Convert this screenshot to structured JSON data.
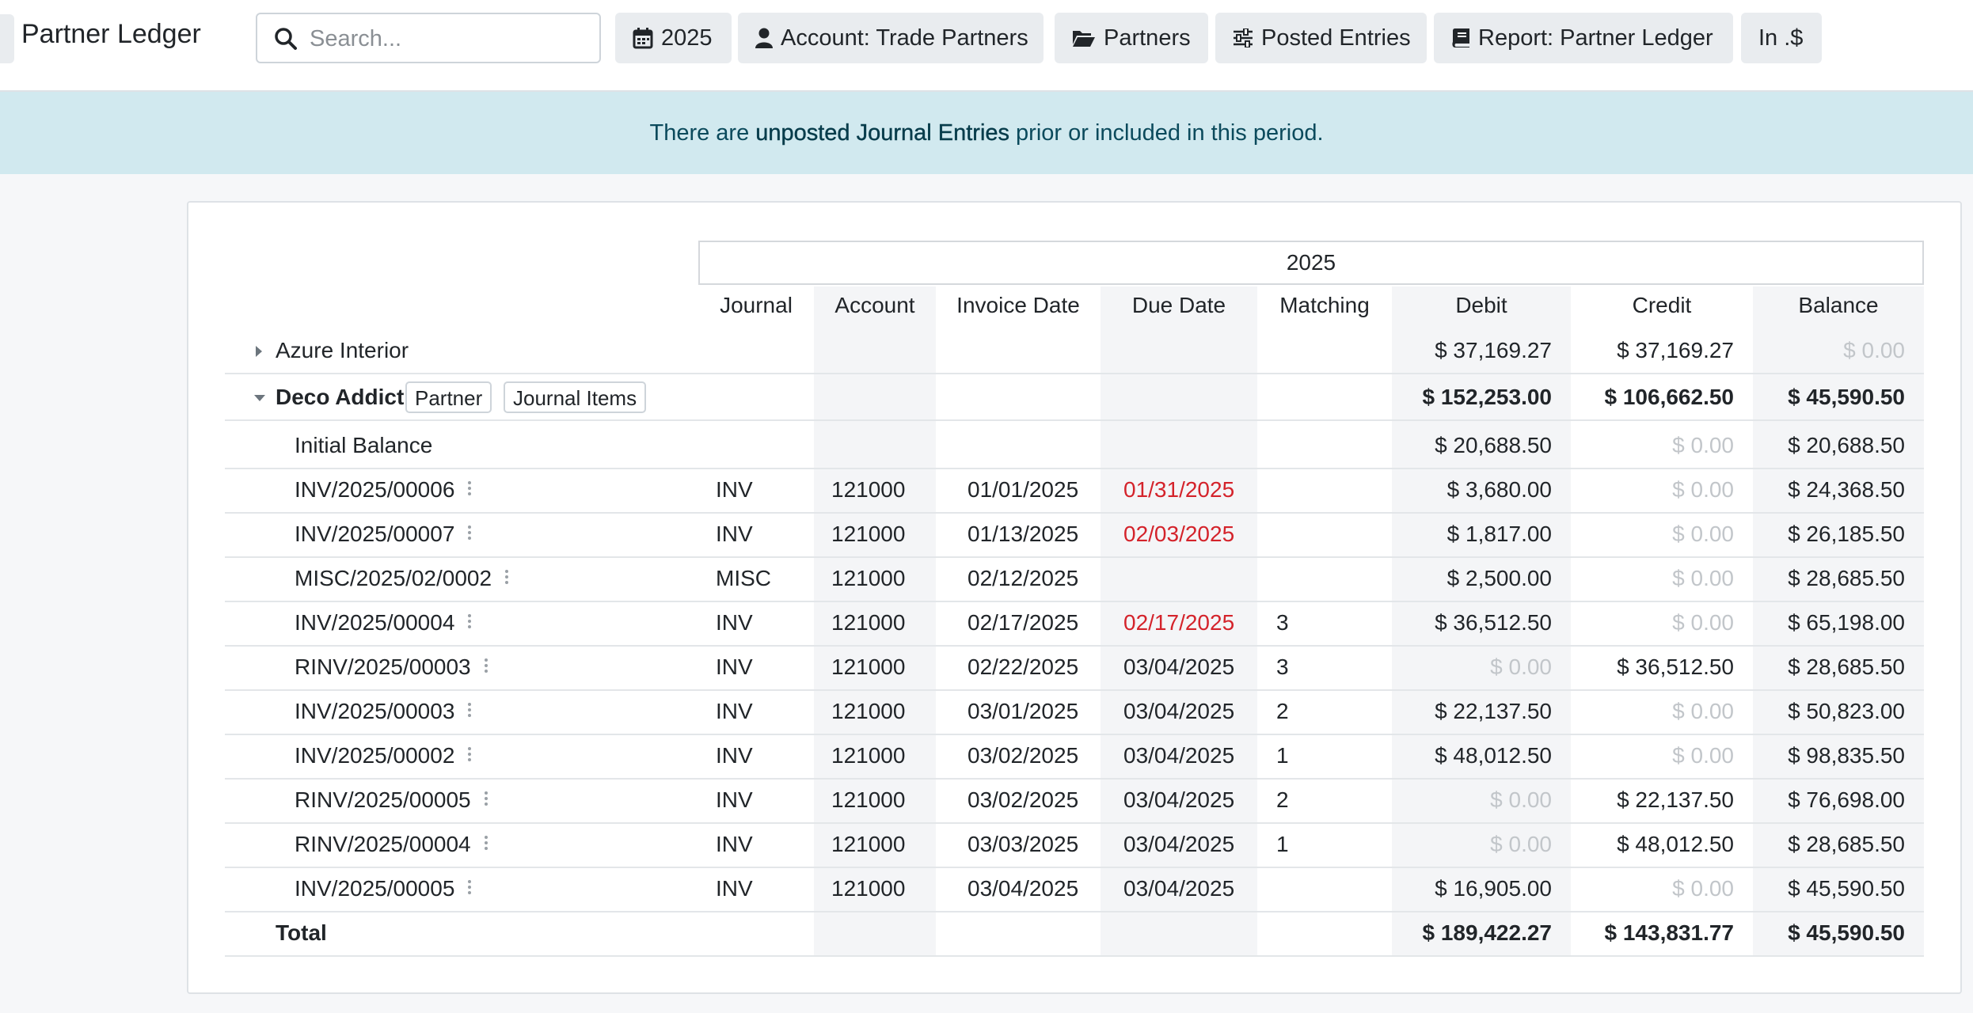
{
  "header": {
    "title": "Partner Ledger",
    "search_placeholder": "Search...",
    "filters": {
      "year": "2025",
      "account": "Account: Trade Partners",
      "partners": "Partners",
      "posted": "Posted Entries",
      "report": "Report: Partner Ledger",
      "currency": "In .$"
    }
  },
  "banner": {
    "prefix": "There are",
    "link": "unposted Journal Entries",
    "suffix": "prior or included in this period."
  },
  "table": {
    "period": "2025",
    "columns": {
      "journal": "Journal",
      "account": "Account",
      "invoice_date": "Invoice Date",
      "due_date": "Due Date",
      "matching": "Matching",
      "debit": "Debit",
      "credit": "Credit",
      "balance": "Balance"
    },
    "partners": [
      {
        "name": "Azure Interior",
        "debit": "$ 37,169.27",
        "credit": "$ 37,169.27",
        "balance": "$ 0.00"
      },
      {
        "name": "Deco Addict",
        "debit": "$ 152,253.00",
        "credit": "$ 106,662.50",
        "balance": "$ 45,590.50",
        "tag_partner": "Partner",
        "tag_items": "Journal Items"
      }
    ],
    "initial_balance": {
      "label": "Initial Balance",
      "debit": "$ 20,688.50",
      "credit": "$ 0.00",
      "balance": "$ 20,688.50"
    },
    "lines": [
      {
        "move": "INV/2025/00006",
        "journal": "INV",
        "account": "121000",
        "invoice_date": "01/01/2025",
        "due_date": "01/31/2025",
        "overdue": true,
        "matching": "",
        "debit": "$ 3,680.00",
        "credit": "$ 0.00",
        "balance": "$ 24,368.50"
      },
      {
        "move": "INV/2025/00007",
        "journal": "INV",
        "account": "121000",
        "invoice_date": "01/13/2025",
        "due_date": "02/03/2025",
        "overdue": true,
        "matching": "",
        "debit": "$ 1,817.00",
        "credit": "$ 0.00",
        "balance": "$ 26,185.50"
      },
      {
        "move": "MISC/2025/02/0002",
        "journal": "MISC",
        "account": "121000",
        "invoice_date": "02/12/2025",
        "due_date": "",
        "overdue": false,
        "matching": "",
        "debit": "$ 2,500.00",
        "credit": "$ 0.00",
        "balance": "$ 28,685.50"
      },
      {
        "move": "INV/2025/00004",
        "journal": "INV",
        "account": "121000",
        "invoice_date": "02/17/2025",
        "due_date": "02/17/2025",
        "overdue": true,
        "matching": "3",
        "debit": "$ 36,512.50",
        "credit": "$ 0.00",
        "balance": "$ 65,198.00"
      },
      {
        "move": "RINV/2025/00003",
        "journal": "INV",
        "account": "121000",
        "invoice_date": "02/22/2025",
        "due_date": "03/04/2025",
        "overdue": false,
        "matching": "3",
        "debit": "$ 0.00",
        "credit": "$ 36,512.50",
        "balance": "$ 28,685.50"
      },
      {
        "move": "INV/2025/00003",
        "journal": "INV",
        "account": "121000",
        "invoice_date": "03/01/2025",
        "due_date": "03/04/2025",
        "overdue": false,
        "matching": "2",
        "debit": "$ 22,137.50",
        "credit": "$ 0.00",
        "balance": "$ 50,823.00"
      },
      {
        "move": "INV/2025/00002",
        "journal": "INV",
        "account": "121000",
        "invoice_date": "03/02/2025",
        "due_date": "03/04/2025",
        "overdue": false,
        "matching": "1",
        "debit": "$ 48,012.50",
        "credit": "$ 0.00",
        "balance": "$ 98,835.50"
      },
      {
        "move": "RINV/2025/00005",
        "journal": "INV",
        "account": "121000",
        "invoice_date": "03/02/2025",
        "due_date": "03/04/2025",
        "overdue": false,
        "matching": "2",
        "debit": "$ 0.00",
        "credit": "$ 22,137.50",
        "balance": "$ 76,698.00"
      },
      {
        "move": "RINV/2025/00004",
        "journal": "INV",
        "account": "121000",
        "invoice_date": "03/03/2025",
        "due_date": "03/04/2025",
        "overdue": false,
        "matching": "1",
        "debit": "$ 0.00",
        "credit": "$ 48,012.50",
        "balance": "$ 28,685.50"
      },
      {
        "move": "INV/2025/00005",
        "journal": "INV",
        "account": "121000",
        "invoice_date": "03/04/2025",
        "due_date": "03/04/2025",
        "overdue": false,
        "matching": "",
        "debit": "$ 16,905.00",
        "credit": "$ 0.00",
        "balance": "$ 45,590.50"
      }
    ],
    "total": {
      "label": "Total",
      "debit": "$ 189,422.27",
      "credit": "$ 143,831.77",
      "balance": "$ 45,590.50"
    }
  },
  "colors": {
    "banner_bg": "#d1e9ef",
    "overdue": "#d4232b",
    "zero": "#c2c6ca",
    "shaded_column": "#f4f5f7"
  }
}
